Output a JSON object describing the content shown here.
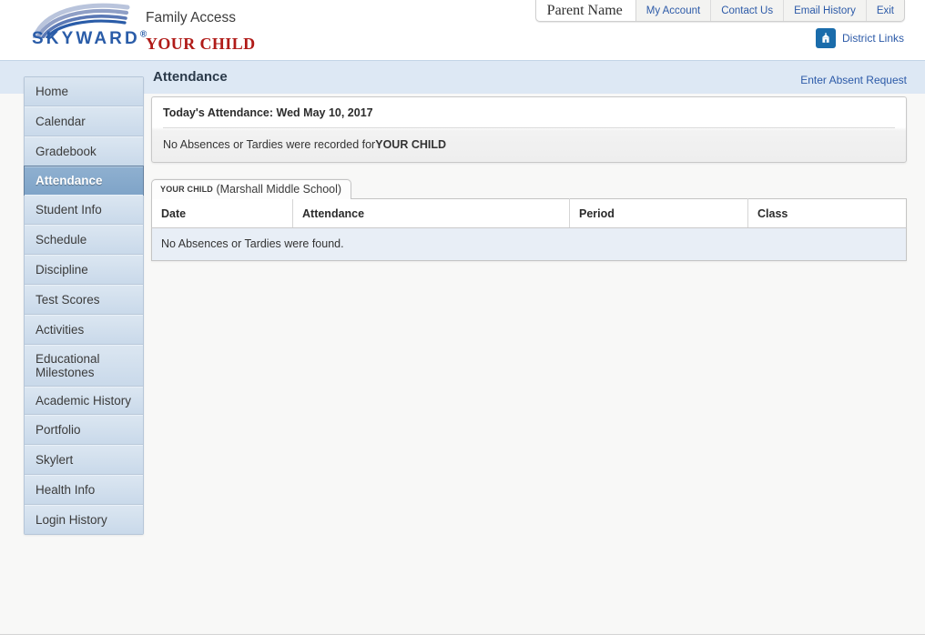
{
  "header": {
    "logo_text": "SKYWARD",
    "logo_reg": "®",
    "app_title": "Family Access",
    "student_name": "YOUR CHILD",
    "parent_name": "Parent Name",
    "nav_links": [
      {
        "label": "My Account"
      },
      {
        "label": "Contact Us"
      },
      {
        "label": "Email History"
      },
      {
        "label": "Exit"
      }
    ],
    "district_links": {
      "label": "District Links",
      "icon": "school-building-icon",
      "icon_bg": "#1a6cab"
    }
  },
  "sidebar": {
    "items": [
      {
        "label": "Home",
        "selected": false
      },
      {
        "label": "Calendar",
        "selected": false
      },
      {
        "label": "Gradebook",
        "selected": false
      },
      {
        "label": "Attendance",
        "selected": true
      },
      {
        "label": "Student Info",
        "selected": false
      },
      {
        "label": "Schedule",
        "selected": false
      },
      {
        "label": "Discipline",
        "selected": false
      },
      {
        "label": "Test Scores",
        "selected": false
      },
      {
        "label": "Activities",
        "selected": false
      },
      {
        "label": "Educational Milestones",
        "selected": false
      },
      {
        "label": "Academic History",
        "selected": false
      },
      {
        "label": "Portfolio",
        "selected": false
      },
      {
        "label": "Skylert",
        "selected": false
      },
      {
        "label": "Health Info",
        "selected": false
      },
      {
        "label": "Login History",
        "selected": false
      }
    ]
  },
  "main": {
    "page_title": "Attendance",
    "head_link": "Enter Absent Request",
    "today_panel": {
      "heading": "Today's Attendance: Wed May 10, 2017",
      "body_prefix": "No Absences or Tardies were recorded for",
      "body_child": "YOUR CHILD"
    },
    "tab": {
      "child": "YOUR CHILD",
      "school": "(Marshall Middle School)"
    },
    "table": {
      "columns": [
        "Date",
        "Attendance",
        "Period",
        "Class"
      ],
      "empty_message": "No Absences or Tardies were found.",
      "rows": []
    }
  },
  "colors": {
    "accent_link": "#2c5aa8",
    "brand_blue": "#2a5ca8",
    "child_red": "#b01b18",
    "band_blue": "#dde8f4",
    "sidebar_blue": "#cedceb",
    "selected_blue": "#7fa4c8",
    "row_blue": "#e8eef6"
  }
}
